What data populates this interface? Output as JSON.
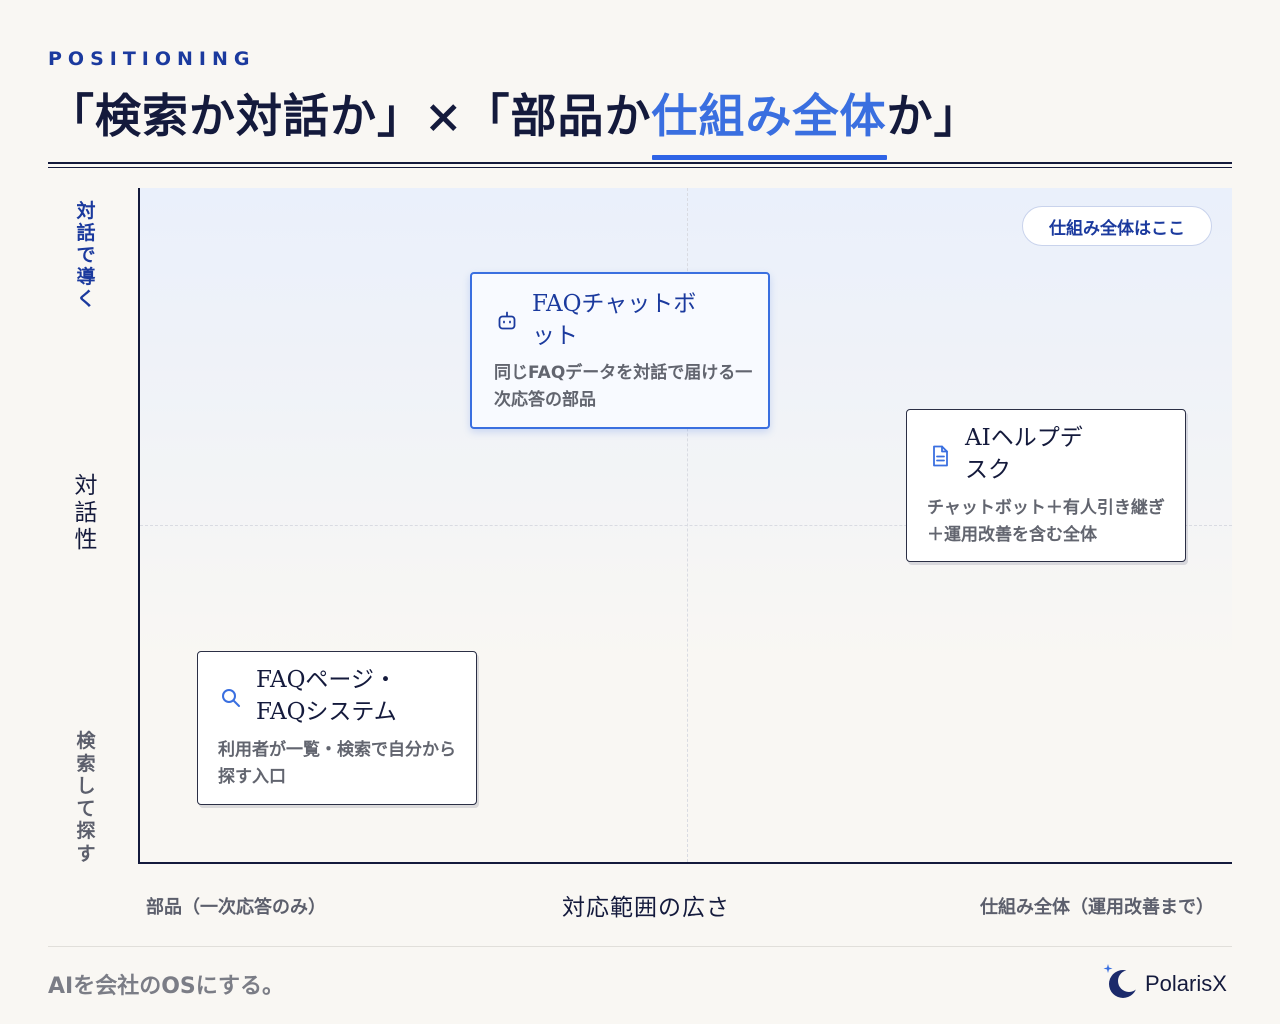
{
  "header": {
    "eyebrow": "POSITIONING",
    "title_pre": "「検索か対話か」×「部品か",
    "title_highlight": "仕組み全体",
    "title_post": "か」"
  },
  "y_axis": {
    "top_label": "対話で導く",
    "title": "対話性",
    "bottom_label": "検索して探す"
  },
  "x_axis": {
    "left_label": "部品（一次応答のみ）",
    "title": "対応範囲の広さ",
    "right_label": "仕組み全体（運用改善まで）"
  },
  "badge": {
    "label": "仕組み全体はここ"
  },
  "cards": [
    {
      "icon": "robot-icon",
      "title": "FAQチャットボット",
      "description": "同じFAQデータを対話で届ける一次応答の部品",
      "highlighted": true
    },
    {
      "icon": "document-icon",
      "title": "AIヘルプデスク",
      "description": "チャットボット＋有人引き継ぎ＋運用改善を含む全体",
      "highlighted": false
    },
    {
      "icon": "search-icon",
      "title": "FAQページ・FAQシステム",
      "description": "利用者が一覧・検索で自分から探す入口",
      "highlighted": false
    }
  ],
  "footer": {
    "tagline": "AIを会社のOSにする。",
    "brand": "PolarisX"
  },
  "colors": {
    "accent": "#3a6fe0",
    "navy": "#141a3c",
    "deep_blue": "#1b3a9e",
    "background": "#f9f7f3"
  }
}
